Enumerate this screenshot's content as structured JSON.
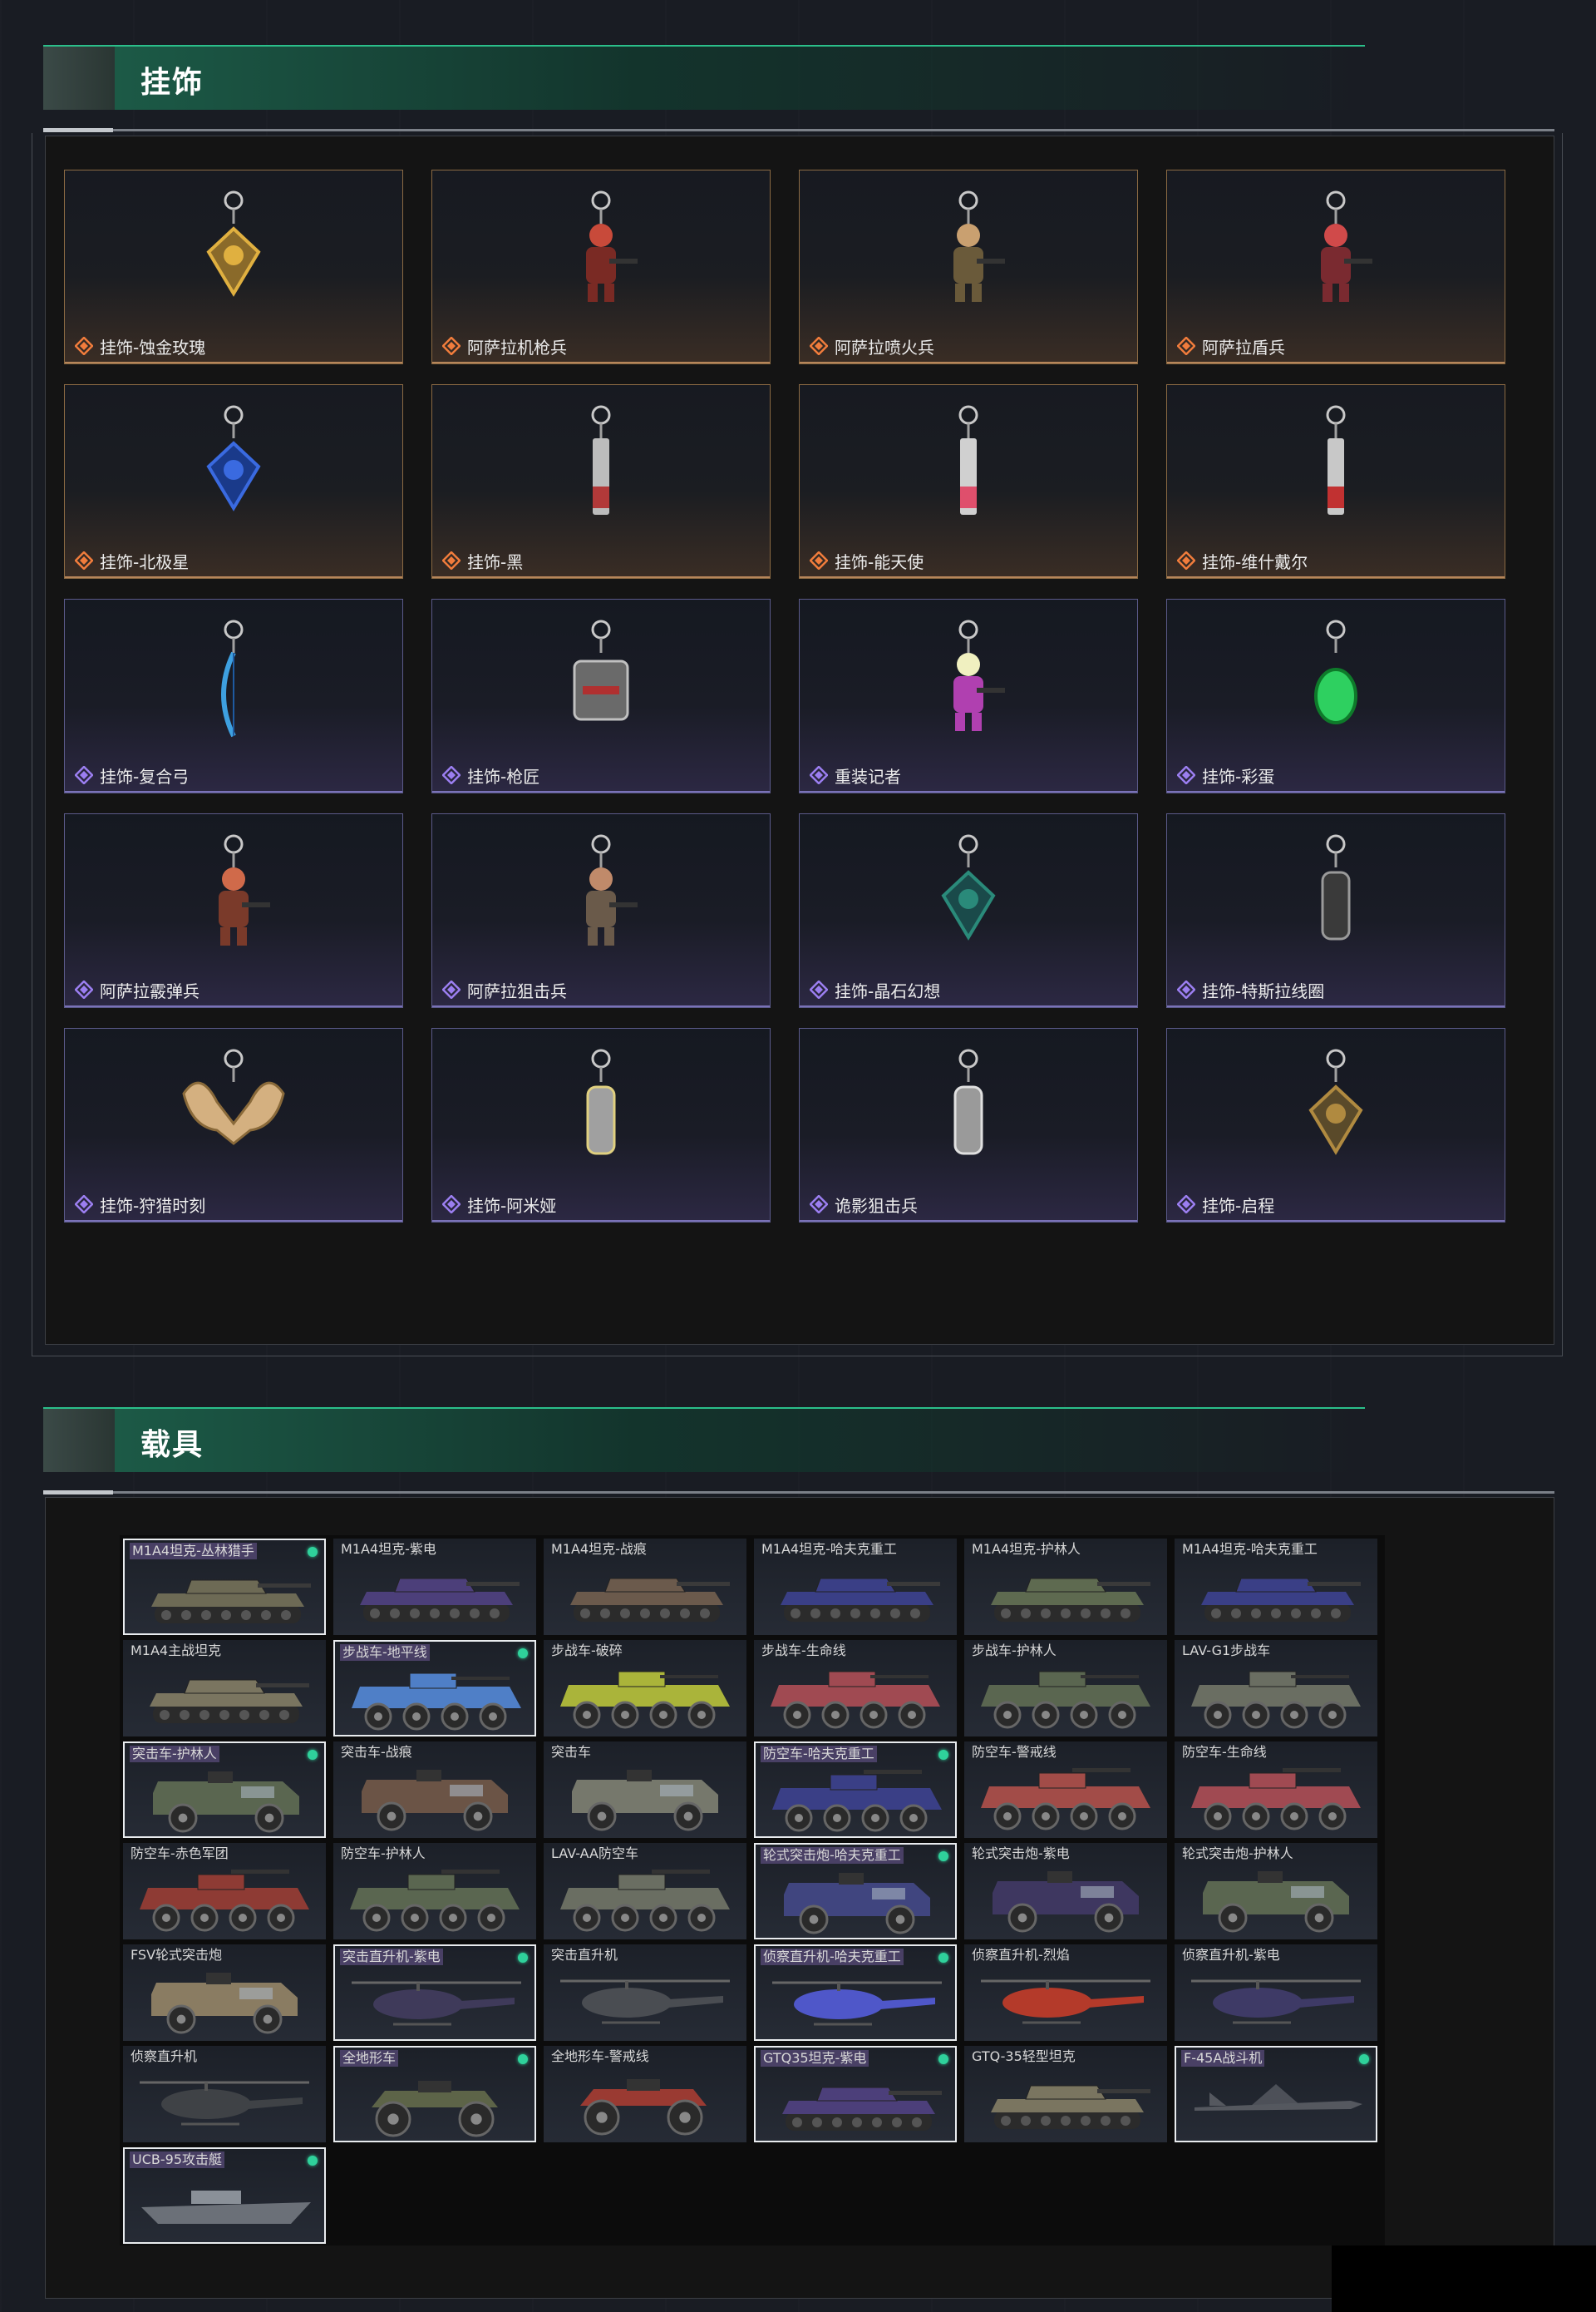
{
  "sections": {
    "charms": {
      "title": "挂饰"
    },
    "vehicles": {
      "title": "载具"
    }
  },
  "colors": {
    "accent_green": "#2bbf8a",
    "rarity_orange": "#f07c3c",
    "rarity_purple": "#9b7ef0",
    "owned_dot": "#2fd19b"
  },
  "charms": [
    {
      "name": "挂饰-蚀金玫瑰",
      "rarity": "orange",
      "icon": "rose-medal-charm-icon"
    },
    {
      "name": "阿萨拉机枪兵",
      "rarity": "orange",
      "icon": "machinegunner-figure-icon"
    },
    {
      "name": "阿萨拉喷火兵",
      "rarity": "orange",
      "icon": "flamethrower-figure-icon"
    },
    {
      "name": "阿萨拉盾兵",
      "rarity": "orange",
      "icon": "shield-soldier-figure-icon"
    },
    {
      "name": "挂饰-北极星",
      "rarity": "orange",
      "icon": "blue-star-charm-icon"
    },
    {
      "name": "挂饰-黑",
      "rarity": "orange",
      "icon": "black-tag-charm-icon"
    },
    {
      "name": "挂饰-能天使",
      "rarity": "orange",
      "icon": "angel-tag-charm-icon"
    },
    {
      "name": "挂饰-维什戴尔",
      "rarity": "orange",
      "icon": "red-tag-charm-icon"
    },
    {
      "name": "挂饰-复合弓",
      "rarity": "purple",
      "icon": "compound-bow-charm-icon"
    },
    {
      "name": "挂饰-枪匠",
      "rarity": "purple",
      "icon": "gunsmith-box-charm-icon"
    },
    {
      "name": "重装记者",
      "rarity": "purple",
      "icon": "reporter-figure-icon"
    },
    {
      "name": "挂饰-彩蛋",
      "rarity": "purple",
      "icon": "green-egg-charm-icon"
    },
    {
      "name": "阿萨拉霰弹兵",
      "rarity": "purple",
      "icon": "shotgunner-figure-icon"
    },
    {
      "name": "阿萨拉狙击兵",
      "rarity": "purple",
      "icon": "sniper-figure-icon"
    },
    {
      "name": "挂饰-晶石幻想",
      "rarity": "purple",
      "icon": "crystal-charm-icon"
    },
    {
      "name": "挂饰-特斯拉线圈",
      "rarity": "purple",
      "icon": "tesla-coil-charm-icon"
    },
    {
      "name": "挂饰-狩猎时刻",
      "rarity": "purple",
      "icon": "moose-antler-charm-icon"
    },
    {
      "name": "挂饰-阿米娅",
      "rarity": "purple",
      "icon": "bunny-charm-icon"
    },
    {
      "name": "诡影狙击兵",
      "rarity": "purple",
      "icon": "ghost-sniper-charm-icon"
    },
    {
      "name": "挂饰-启程",
      "rarity": "purple",
      "icon": "departure-medal-charm-icon"
    }
  ],
  "vehicles": [
    {
      "name": "M1A4坦克-丛林猎手",
      "kind": "tank",
      "selected": true,
      "owned": true,
      "color": "#6d6a55"
    },
    {
      "name": "M1A4坦克-紫电",
      "kind": "tank",
      "selected": false,
      "owned": false,
      "color": "#4c3f7a"
    },
    {
      "name": "M1A4坦克-战痕",
      "kind": "tank",
      "selected": false,
      "owned": false,
      "color": "#6b5a4c"
    },
    {
      "name": "M1A4坦克-哈夫克重工",
      "kind": "tank",
      "selected": false,
      "owned": false,
      "color": "#3a3f86"
    },
    {
      "name": "M1A4坦克-护林人",
      "kind": "tank",
      "selected": false,
      "owned": false,
      "color": "#5e6a50"
    },
    {
      "name": "M1A4坦克-哈夫克重工",
      "kind": "tank",
      "selected": false,
      "owned": false,
      "color": "#3a3f86"
    },
    {
      "name": "M1A4主战坦克",
      "kind": "tank",
      "selected": false,
      "owned": false,
      "color": "#7a7560"
    },
    {
      "name": "步战车-地平线",
      "kind": "apc",
      "selected": true,
      "owned": true,
      "color": "#4f7fc7"
    },
    {
      "name": "步战车-破碎",
      "kind": "apc",
      "selected": false,
      "owned": false,
      "color": "#aab43a"
    },
    {
      "name": "步战车-生命线",
      "kind": "apc",
      "selected": false,
      "owned": false,
      "color": "#a04a52"
    },
    {
      "name": "步战车-护林人",
      "kind": "apc",
      "selected": false,
      "owned": false,
      "color": "#5a6650"
    },
    {
      "name": "LAV-G1步战车",
      "kind": "apc",
      "selected": false,
      "owned": false,
      "color": "#6a6e62"
    },
    {
      "name": "突击车-护林人",
      "kind": "mrap",
      "selected": true,
      "owned": true,
      "color": "#5a6650"
    },
    {
      "name": "突击车-战痕",
      "kind": "mrap",
      "selected": false,
      "owned": false,
      "color": "#6b5446"
    },
    {
      "name": "突击车",
      "kind": "mrap",
      "selected": false,
      "owned": false,
      "color": "#76786c"
    },
    {
      "name": "防空车-哈夫克重工",
      "kind": "aa",
      "selected": true,
      "owned": true,
      "color": "#3a3f86"
    },
    {
      "name": "防空车-警戒线",
      "kind": "aa",
      "selected": false,
      "owned": false,
      "color": "#a24c48"
    },
    {
      "name": "防空车-生命线",
      "kind": "aa",
      "selected": false,
      "owned": false,
      "color": "#a04a52"
    },
    {
      "name": "防空车-赤色军团",
      "kind": "aa",
      "selected": false,
      "owned": false,
      "color": "#8e3b34"
    },
    {
      "name": "防空车-护林人",
      "kind": "aa",
      "selected": false,
      "owned": false,
      "color": "#5a6650"
    },
    {
      "name": "LAV-AA防空车",
      "kind": "aa",
      "selected": false,
      "owned": false,
      "color": "#6a6e62"
    },
    {
      "name": "轮式突击炮-哈夫克重工",
      "kind": "mrap",
      "selected": true,
      "owned": true,
      "color": "#40457f"
    },
    {
      "name": "轮式突击炮-紫电",
      "kind": "mrap",
      "selected": false,
      "owned": false,
      "color": "#3e3760"
    },
    {
      "name": "轮式突击炮-护林人",
      "kind": "mrap",
      "selected": false,
      "owned": false,
      "color": "#5a6650"
    },
    {
      "name": "FSV轮式突击炮",
      "kind": "mrap",
      "selected": false,
      "owned": false,
      "color": "#8a7c62"
    },
    {
      "name": "突击直升机-紫电",
      "kind": "heli",
      "selected": true,
      "owned": true,
      "color": "#3f3a5a"
    },
    {
      "name": "突击直升机",
      "kind": "heli",
      "selected": false,
      "owned": false,
      "color": "#4a4d52"
    },
    {
      "name": "侦察直升机-哈夫克重工",
      "kind": "heli",
      "selected": true,
      "owned": true,
      "color": "#4f57c9"
    },
    {
      "name": "侦察直升机-烈焰",
      "kind": "heli",
      "selected": false,
      "owned": false,
      "color": "#b43a2a"
    },
    {
      "name": "侦察直升机-紫电",
      "kind": "heli",
      "selected": false,
      "owned": false,
      "color": "#3e3a66"
    },
    {
      "name": "侦察直升机",
      "kind": "heli",
      "selected": false,
      "owned": false,
      "color": "#3f4246"
    },
    {
      "name": "全地形车",
      "kind": "atv",
      "selected": true,
      "owned": true,
      "color": "#5d6448"
    },
    {
      "name": "全地形车-警戒线",
      "kind": "atv",
      "selected": false,
      "owned": false,
      "color": "#9a3a32"
    },
    {
      "name": "GTQ35坦克-紫电",
      "kind": "tank",
      "selected": true,
      "owned": true,
      "color": "#4c3f7a"
    },
    {
      "name": "GTQ-35轻型坦克",
      "kind": "tank",
      "selected": false,
      "owned": false,
      "color": "#7a7560"
    },
    {
      "name": "F-45A战斗机",
      "kind": "jet",
      "selected": true,
      "owned": true,
      "color": "#55585f"
    },
    {
      "name": "UCB-95攻击艇",
      "kind": "boat",
      "selected": true,
      "owned": true,
      "color": "#6b7078"
    }
  ]
}
